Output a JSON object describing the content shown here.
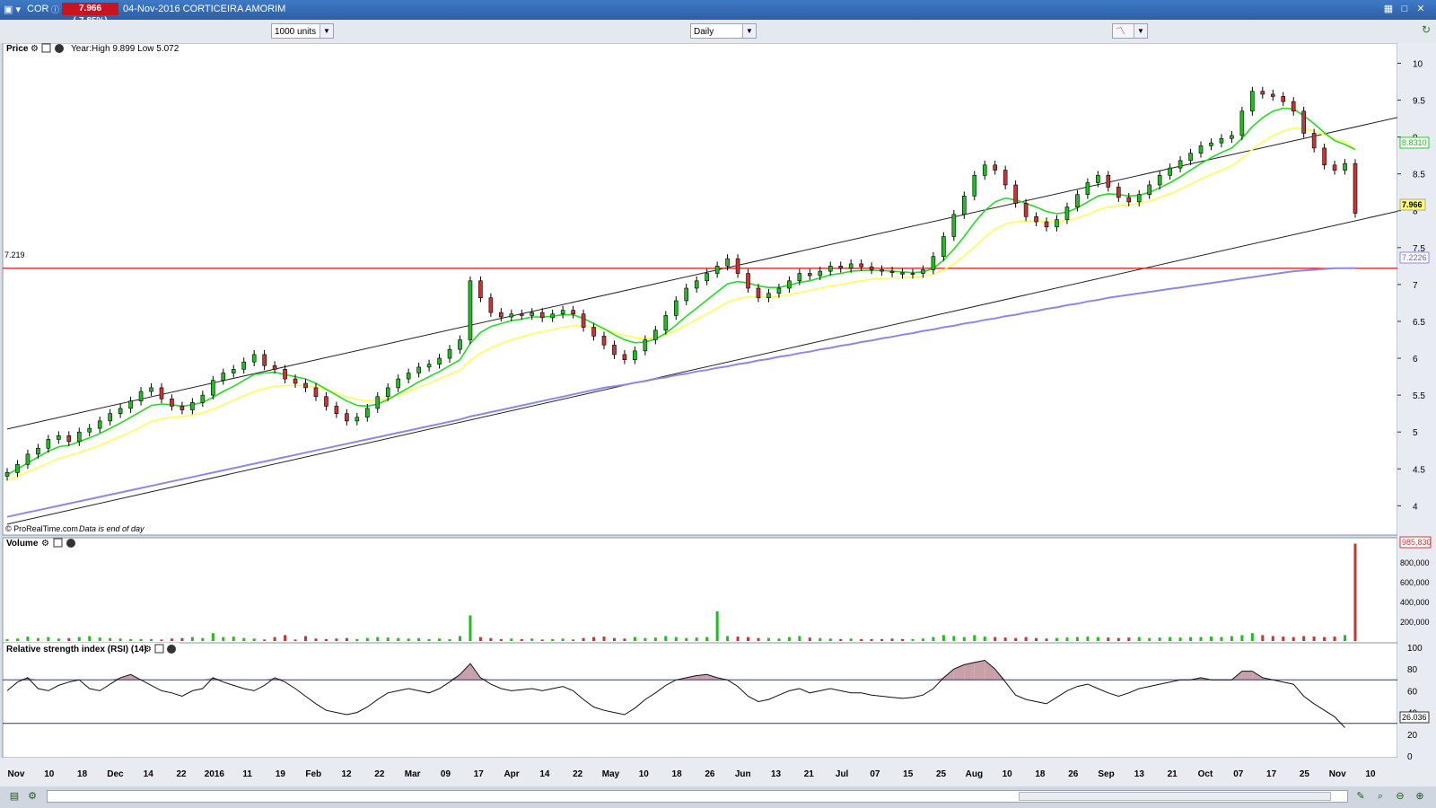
{
  "window": {
    "ticker": "COR",
    "price_badge": "7.966 (-7.85%)",
    "title": "04-Nov-2016 CORTICEIRA AMORIM"
  },
  "toolbar": {
    "units_value": "1000 units",
    "period_value": "Daily"
  },
  "price_panel": {
    "label": "Price",
    "year_info": "Year:High 9.899 Low 5.072",
    "credit": "© ProRealTime.com",
    "credit_note": "Data is end of day",
    "hline_label": "7.219",
    "last_price_tag": "7.966",
    "ema_tag": "8.8310",
    "ma200_tag": "7.2226",
    "colors": {
      "ema_fast": "#22dd22",
      "ema_slow": "#ffff55",
      "ma200": "#8888ee",
      "hline": "#dd1111",
      "up": "#22bb22",
      "down": "#cc3333",
      "badge": "#c8141e"
    }
  },
  "volume_panel": {
    "label": "Volume",
    "last_volume_tag": "985,830"
  },
  "rsi_panel": {
    "label": "Relative strength index (RSI) (14)",
    "last_rsi_tag": "26.036"
  },
  "chart_data": [
    {
      "type": "candlestick",
      "title": "",
      "ylim": [
        3.7,
        10.2
      ],
      "y_ticks": [
        "10",
        "9.5",
        "9",
        "8.5",
        "8",
        "7.5",
        "7",
        "6.5",
        "6",
        "5.5",
        "5",
        "4.5",
        "4"
      ],
      "x_tick_labels": [
        "Nov",
        "10",
        "18",
        "Dec",
        "14",
        "22",
        "2016",
        "11",
        "19",
        "Feb",
        "12",
        "22",
        "Mar",
        "09",
        "17",
        "Apr",
        "14",
        "22",
        "May",
        "10",
        "18",
        "26",
        "Jun",
        "13",
        "21",
        "Jul",
        "07",
        "15",
        "25",
        "Aug",
        "10",
        "18",
        "26",
        "Sep",
        "13",
        "21",
        "Oct",
        "07",
        "17",
        "25",
        "Nov",
        "10"
      ],
      "horizontal_line": 7.219,
      "trend_channel": {
        "upper": [
          [
            0,
            5.04
          ],
          [
            150,
            9.73
          ]
        ],
        "lower": [
          [
            0,
            3.75
          ],
          [
            150,
            8.46
          ]
        ]
      },
      "close": [
        4.45,
        4.56,
        4.7,
        4.78,
        4.9,
        4.95,
        4.87,
        5.0,
        5.05,
        5.15,
        5.25,
        5.32,
        5.42,
        5.55,
        5.6,
        5.45,
        5.35,
        5.3,
        5.4,
        5.5,
        5.7,
        5.8,
        5.85,
        5.95,
        6.05,
        5.9,
        5.85,
        5.72,
        5.66,
        5.6,
        5.48,
        5.35,
        5.25,
        5.15,
        5.2,
        5.32,
        5.48,
        5.6,
        5.72,
        5.8,
        5.88,
        5.92,
        6.0,
        6.12,
        6.25,
        7.05,
        6.82,
        6.62,
        6.56,
        6.6,
        6.58,
        6.62,
        6.55,
        6.6,
        6.65,
        6.6,
        6.42,
        6.3,
        6.18,
        6.05,
        5.98,
        6.1,
        6.25,
        6.38,
        6.58,
        6.78,
        6.95,
        7.05,
        7.15,
        7.25,
        7.35,
        7.15,
        6.95,
        6.82,
        6.88,
        6.95,
        7.05,
        7.15,
        7.12,
        7.18,
        7.25,
        7.22,
        7.28,
        7.24,
        7.2,
        7.18,
        7.16,
        7.14,
        7.15,
        7.2,
        7.38,
        7.65,
        7.95,
        8.2,
        8.48,
        8.62,
        8.55,
        8.35,
        8.1,
        7.92,
        7.85,
        7.78,
        7.88,
        8.05,
        8.22,
        8.38,
        8.48,
        8.32,
        8.18,
        8.12,
        8.22,
        8.35,
        8.48,
        8.58,
        8.68,
        8.78,
        8.88,
        8.92,
        8.98,
        9.02,
        9.35,
        9.62,
        9.58,
        9.55,
        9.48,
        9.35,
        9.05,
        8.85,
        8.62,
        8.55,
        8.64,
        7.966
      ],
      "ema_fast": [
        4.42,
        4.5,
        4.58,
        4.66,
        4.74,
        4.8,
        4.82,
        4.87,
        4.92,
        4.98,
        5.05,
        5.12,
        5.2,
        5.28,
        5.36,
        5.38,
        5.37,
        5.35,
        5.37,
        5.4,
        5.47,
        5.55,
        5.62,
        5.7,
        5.78,
        5.8,
        5.81,
        5.78,
        5.75,
        5.72,
        5.66,
        5.58,
        5.5,
        5.42,
        5.36,
        5.35,
        5.38,
        5.44,
        5.52,
        5.6,
        5.68,
        5.75,
        5.82,
        5.9,
        5.98,
        6.2,
        6.35,
        6.43,
        6.47,
        6.51,
        6.53,
        6.56,
        6.56,
        6.57,
        6.59,
        6.59,
        6.54,
        6.47,
        6.4,
        6.32,
        6.25,
        6.21,
        6.22,
        6.26,
        6.34,
        6.45,
        6.57,
        6.68,
        6.79,
        6.9,
        7.01,
        7.04,
        7.02,
        6.98,
        6.96,
        6.96,
        6.99,
        7.03,
        7.05,
        7.09,
        7.13,
        7.15,
        7.18,
        7.19,
        7.19,
        7.19,
        7.18,
        7.17,
        7.16,
        7.17,
        7.22,
        7.33,
        7.48,
        7.65,
        7.84,
        8.0,
        8.12,
        8.17,
        8.15,
        8.1,
        8.05,
        7.99,
        7.96,
        7.98,
        8.04,
        8.12,
        8.2,
        8.23,
        8.22,
        8.2,
        8.21,
        8.25,
        8.31,
        8.38,
        8.46,
        8.55,
        8.64,
        8.72,
        8.79,
        8.85,
        8.98,
        9.14,
        9.26,
        9.35,
        9.39,
        9.38,
        9.29,
        9.18,
        9.06,
        8.95,
        8.9,
        8.83
      ],
      "ema_slow": [
        4.35,
        4.4,
        4.46,
        4.52,
        4.58,
        4.64,
        4.68,
        4.72,
        4.77,
        4.82,
        4.88,
        4.94,
        5.0,
        5.07,
        5.14,
        5.18,
        5.2,
        5.21,
        5.23,
        5.26,
        5.31,
        5.37,
        5.43,
        5.49,
        5.55,
        5.59,
        5.62,
        5.63,
        5.63,
        5.63,
        5.61,
        5.57,
        5.53,
        5.48,
        5.44,
        5.42,
        5.43,
        5.46,
        5.5,
        5.55,
        5.61,
        5.66,
        5.72,
        5.78,
        5.84,
        5.97,
        6.07,
        6.14,
        6.2,
        6.25,
        6.29,
        6.33,
        6.36,
        6.39,
        6.42,
        6.44,
        6.44,
        6.42,
        6.39,
        6.35,
        6.31,
        6.28,
        6.27,
        6.28,
        6.32,
        6.38,
        6.45,
        6.53,
        6.6,
        6.68,
        6.76,
        6.81,
        6.83,
        6.83,
        6.83,
        6.84,
        6.86,
        6.89,
        6.92,
        6.95,
        6.98,
        7.0,
        7.03,
        7.05,
        7.07,
        7.08,
        7.09,
        7.09,
        7.1,
        7.11,
        7.14,
        7.2,
        7.28,
        7.39,
        7.51,
        7.64,
        7.75,
        7.82,
        7.85,
        7.86,
        7.86,
        7.85,
        7.85,
        7.87,
        7.9,
        7.95,
        8.01,
        8.05,
        8.07,
        8.08,
        8.1,
        8.13,
        8.18,
        8.23,
        8.29,
        8.36,
        8.43,
        8.49,
        8.55,
        8.61,
        8.71,
        8.83,
        8.93,
        9.02,
        9.08,
        9.12,
        9.11,
        9.08,
        9.03,
        8.97,
        8.94,
        8.83
      ],
      "ma200": [
        3.85,
        3.88,
        3.91,
        3.94,
        3.97,
        4.0,
        4.03,
        4.06,
        4.09,
        4.12,
        4.15,
        4.18,
        4.21,
        4.24,
        4.27,
        4.3,
        4.33,
        4.36,
        4.39,
        4.42,
        4.45,
        4.48,
        4.51,
        4.54,
        4.57,
        4.6,
        4.63,
        4.66,
        4.69,
        4.72,
        4.75,
        4.78,
        4.81,
        4.84,
        4.87,
        4.9,
        4.93,
        4.96,
        4.99,
        5.02,
        5.05,
        5.08,
        5.11,
        5.14,
        5.17,
        5.21,
        5.24,
        5.27,
        5.3,
        5.33,
        5.36,
        5.39,
        5.42,
        5.45,
        5.48,
        5.51,
        5.54,
        5.57,
        5.6,
        5.62,
        5.64,
        5.67,
        5.69,
        5.72,
        5.74,
        5.77,
        5.79,
        5.82,
        5.84,
        5.87,
        5.89,
        5.92,
        5.94,
        5.97,
        5.99,
        6.02,
        6.04,
        6.07,
        6.09,
        6.12,
        6.14,
        6.17,
        6.19,
        6.22,
        6.24,
        6.27,
        6.29,
        6.32,
        6.34,
        6.37,
        6.39,
        6.42,
        6.44,
        6.47,
        6.49,
        6.52,
        6.54,
        6.57,
        6.59,
        6.62,
        6.64,
        6.67,
        6.69,
        6.72,
        6.74,
        6.77,
        6.79,
        6.82,
        6.84,
        6.86,
        6.88,
        6.9,
        6.92,
        6.94,
        6.96,
        6.98,
        7.0,
        7.02,
        7.04,
        7.06,
        7.08,
        7.1,
        7.12,
        7.14,
        7.16,
        7.18,
        7.19,
        7.2,
        7.21,
        7.22,
        7.22,
        7.2226
      ]
    },
    {
      "type": "bar",
      "title": "",
      "y_ticks": [
        "800,000",
        "600,000",
        "400,000",
        "200,000"
      ],
      "ylim": [
        0,
        1000000
      ],
      "values": [
        20000,
        25000,
        45000,
        30000,
        40000,
        25000,
        30000,
        40000,
        50000,
        35000,
        30000,
        25000,
        20000,
        20000,
        20000,
        15000,
        25000,
        30000,
        40000,
        30000,
        80000,
        40000,
        45000,
        30000,
        25000,
        15000,
        40000,
        60000,
        15000,
        50000,
        25000,
        20000,
        25000,
        30000,
        20000,
        30000,
        40000,
        35000,
        30000,
        25000,
        30000,
        20000,
        25000,
        20000,
        50000,
        260000,
        40000,
        30000,
        20000,
        25000,
        20000,
        25000,
        15000,
        20000,
        25000,
        15000,
        30000,
        40000,
        45000,
        30000,
        25000,
        40000,
        30000,
        35000,
        50000,
        40000,
        30000,
        35000,
        40000,
        300000,
        50000,
        45000,
        40000,
        30000,
        30000,
        25000,
        40000,
        50000,
        35000,
        30000,
        25000,
        20000,
        25000,
        20000,
        20000,
        20000,
        25000,
        20000,
        20000,
        25000,
        40000,
        60000,
        50000,
        40000,
        60000,
        45000,
        40000,
        35000,
        30000,
        40000,
        30000,
        25000,
        30000,
        35000,
        40000,
        45000,
        40000,
        35000,
        30000,
        35000,
        40000,
        30000,
        35000,
        40000,
        35000,
        40000,
        40000,
        45000,
        40000,
        50000,
        60000,
        80000,
        60000,
        50000,
        45000,
        40000,
        50000,
        45000,
        40000,
        45000,
        60000,
        985830
      ],
      "last_value": 985830
    },
    {
      "type": "line",
      "title": "",
      "ylim": [
        0,
        100
      ],
      "y_ticks": [
        "100",
        "80",
        "60",
        "40",
        "20",
        "0"
      ],
      "levels": [
        70,
        30
      ],
      "values": [
        60,
        68,
        72,
        62,
        60,
        65,
        68,
        70,
        62,
        60,
        66,
        72,
        75,
        70,
        65,
        60,
        58,
        55,
        60,
        62,
        72,
        68,
        65,
        62,
        60,
        65,
        72,
        68,
        62,
        55,
        48,
        42,
        40,
        38,
        40,
        45,
        52,
        58,
        60,
        62,
        60,
        58,
        62,
        68,
        75,
        85,
        72,
        66,
        62,
        60,
        61,
        62,
        60,
        62,
        64,
        60,
        52,
        45,
        42,
        40,
        38,
        44,
        52,
        58,
        65,
        70,
        72,
        74,
        75,
        72,
        70,
        64,
        55,
        50,
        52,
        56,
        60,
        62,
        58,
        60,
        62,
        60,
        58,
        58,
        56,
        55,
        54,
        53,
        54,
        56,
        62,
        72,
        80,
        84,
        86,
        88,
        80,
        68,
        56,
        52,
        50,
        48,
        54,
        60,
        64,
        66,
        62,
        58,
        55,
        58,
        62,
        64,
        66,
        68,
        70,
        70,
        72,
        70,
        70,
        70,
        78,
        78,
        72,
        70,
        68,
        66,
        55,
        48,
        42,
        36,
        26.036
      ],
      "last_value": 26.036
    }
  ]
}
